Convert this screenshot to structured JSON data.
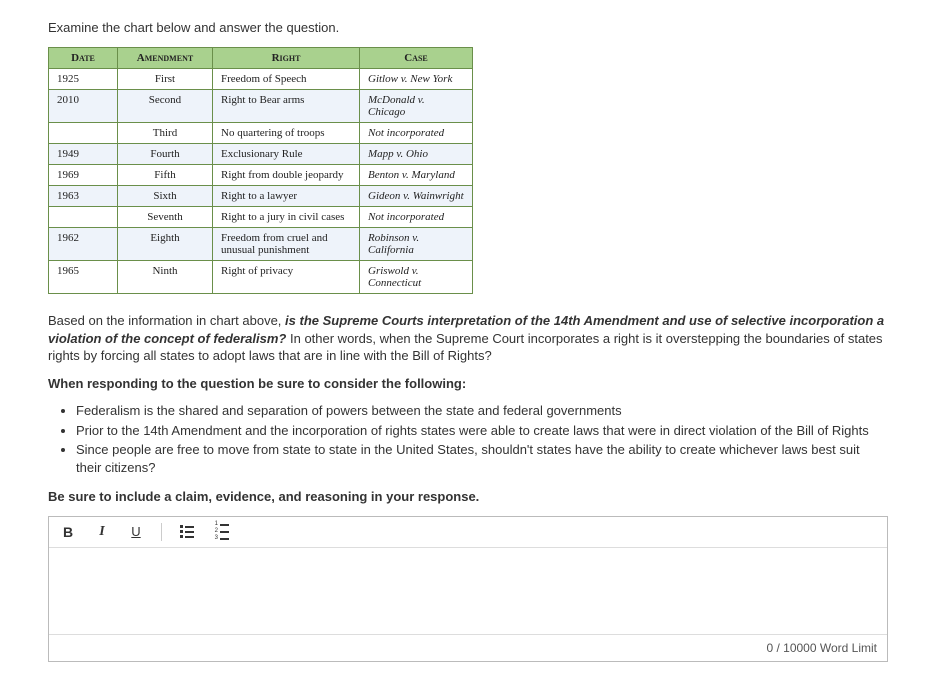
{
  "intro": "Examine the chart below and answer the question.",
  "chart": {
    "headers": [
      "Date",
      "Amendment",
      "Right",
      "Case"
    ],
    "rows": [
      {
        "date": "1925",
        "amendment": "First",
        "right": "Freedom of Speech",
        "case": "Gitlow v. New York"
      },
      {
        "date": "2010",
        "amendment": "Second",
        "right": "Right to Bear arms",
        "case": "McDonald v. Chicago"
      },
      {
        "date": "",
        "amendment": "Third",
        "right": "No quartering of troops",
        "case": "Not incorporated"
      },
      {
        "date": "1949",
        "amendment": "Fourth",
        "right": "Exclusionary Rule",
        "case": "Mapp v. Ohio"
      },
      {
        "date": "1969",
        "amendment": "Fifth",
        "right": "Right from double jeopardy",
        "case": "Benton v. Maryland"
      },
      {
        "date": "1963",
        "amendment": "Sixth",
        "right": "Right to a lawyer",
        "case": "Gideon v. Wainwright"
      },
      {
        "date": "",
        "amendment": "Seventh",
        "right": "Right to a jury in civil cases",
        "case": "Not incorporated"
      },
      {
        "date": "1962",
        "amendment": "Eighth",
        "right": "Freedom from cruel and unusual punishment",
        "case": "Robinson v. California"
      },
      {
        "date": "1965",
        "amendment": "Ninth",
        "right": "Right of privacy",
        "case": "Griswold v. Connecticut"
      }
    ]
  },
  "prompt": {
    "lead_in": "Based on the information in chart above, ",
    "question_italic": "is the Supreme Courts interpretation of the 14th Amendment and use of selective incorporation a violation of the concept of federalism?",
    "follow_up": " In other words, when the Supreme Court incorporates a right is it overstepping the boundaries of states rights by forcing all states to adopt laws that are in line with the Bill of Rights?",
    "consider_heading": "When responding to the question be sure to consider the following:",
    "bullets": [
      "Federalism is the shared and separation of powers between the state and federal governments",
      "Prior to the 14th Amendment and the incorporation of rights states were able to create laws that were in direct violation of the Bill of Rights",
      "Since people are free to move from state to state in the United States, shouldn't states have the ability to create whichever laws best suit their citizens?"
    ],
    "closing_bold": "Be sure to include a claim, evidence, and reasoning in your response."
  },
  "editor": {
    "bold": "B",
    "italic": "I",
    "underline": "U",
    "word_count": "0 / 10000 Word Limit"
  }
}
